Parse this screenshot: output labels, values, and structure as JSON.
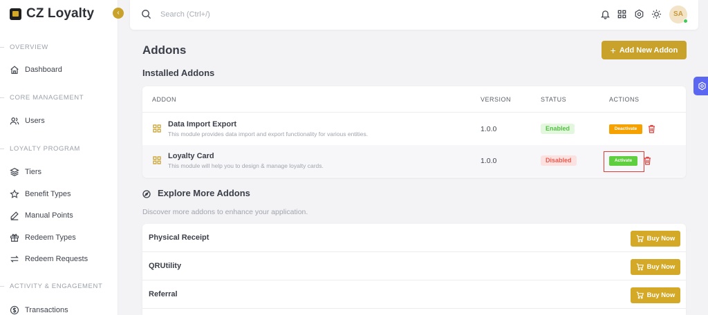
{
  "brand": {
    "name": "CZ Loyalty"
  },
  "sidebar": {
    "collapse_icon": "chevron-left-icon",
    "sections": [
      {
        "label": "OVERVIEW"
      },
      {
        "label": "CORE MANAGEMENT"
      },
      {
        "label": "LOYALTY PROGRAM"
      },
      {
        "label": "ACTIVITY & ENGAGEMENT"
      }
    ],
    "items": [
      {
        "label": "Dashboard",
        "icon": "home-icon"
      },
      {
        "label": "Users",
        "icon": "users-icon"
      },
      {
        "label": "Tiers",
        "icon": "layers-icon"
      },
      {
        "label": "Benefit Types",
        "icon": "star-icon"
      },
      {
        "label": "Manual Points",
        "icon": "pencil-icon"
      },
      {
        "label": "Redeem Types",
        "icon": "gift-icon"
      },
      {
        "label": "Redeem Requests",
        "icon": "swap-icon"
      },
      {
        "label": "Transactions",
        "icon": "dollar-icon"
      }
    ]
  },
  "topbar": {
    "search_placeholder": "Search (Ctrl+/)",
    "icons": [
      "bell-icon",
      "apps-grid-icon",
      "gear-icon",
      "sun-icon"
    ],
    "avatar_initials": "SA"
  },
  "page": {
    "title": "Addons",
    "add_button_label": "Add New Addon",
    "installed_title": "Installed Addons"
  },
  "installed_table": {
    "headers": {
      "addon": "ADDON",
      "version": "VERSION",
      "status": "STATUS",
      "actions": "ACTIONS"
    },
    "rows": [
      {
        "name": "Data Import Export",
        "description": "This module provides data import and export functionality for various entities.",
        "version": "1.0.0",
        "status": "Enabled",
        "action_label": "Deactivate"
      },
      {
        "name": "Loyalty Card",
        "description": "This module will help you to design & manage loyalty cards.",
        "version": "1.0.0",
        "status": "Disabled",
        "action_label": "Activate"
      }
    ]
  },
  "explore": {
    "title": "Explore More Addons",
    "subtitle": "Discover more addons to enhance your application.",
    "items": [
      {
        "name": "Physical Receipt",
        "button_label": "Buy Now"
      },
      {
        "name": "QRUtility",
        "button_label": "Buy Now"
      },
      {
        "name": "Referral",
        "button_label": "Buy Now"
      }
    ]
  },
  "colors": {
    "accent": "#c9a22c",
    "enabled": "#54c043",
    "disabled": "#ee5a4f",
    "deactivate": "#f5a100",
    "activate": "#5fce3f",
    "settings_tab": "#5b67f1"
  }
}
